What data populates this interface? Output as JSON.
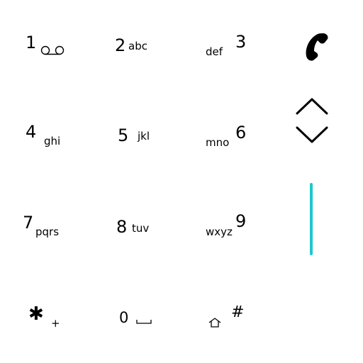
{
  "keypad": {
    "keys": [
      {
        "digit": "1",
        "letters": "",
        "icon": "voicemail-icon"
      },
      {
        "digit": "2",
        "letters": "abc"
      },
      {
        "digit": "3",
        "letters": "def"
      },
      {
        "digit": "4",
        "letters": "ghi"
      },
      {
        "digit": "5",
        "letters": "jkl"
      },
      {
        "digit": "6",
        "letters": "mno"
      },
      {
        "digit": "7",
        "letters": "pqrs"
      },
      {
        "digit": "8",
        "letters": "tuv"
      },
      {
        "digit": "9",
        "letters": "wxyz"
      },
      {
        "digit": "✱",
        "letters": "+"
      },
      {
        "digit": "0",
        "letters": "",
        "icon": "space-icon"
      },
      {
        "digit": "#",
        "letters": "",
        "icon": "home-icon"
      }
    ]
  },
  "side_panel": {
    "call_icon": "phone-call-icon",
    "scroll_up_icon": "chevron-up-icon",
    "scroll_down_icon": "chevron-down-icon",
    "accent_color": "#1ec8cc"
  }
}
